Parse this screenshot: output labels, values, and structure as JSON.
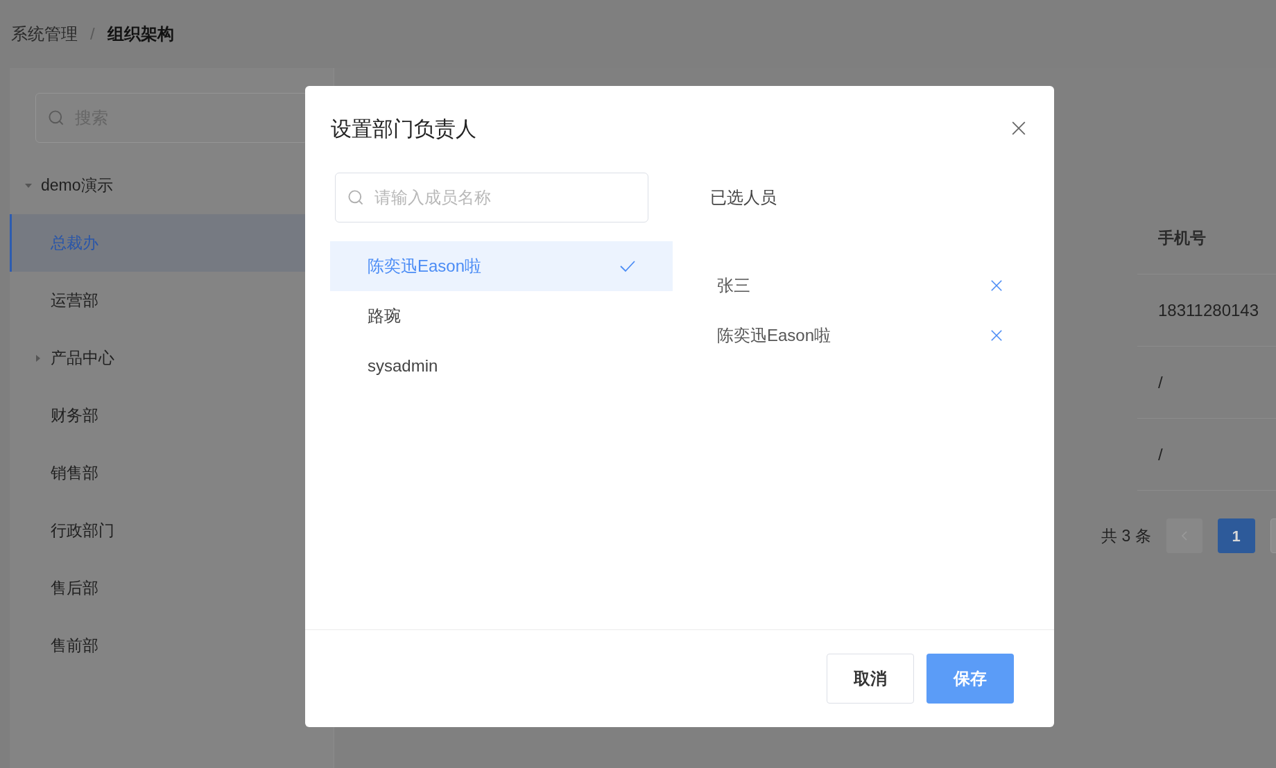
{
  "breadcrumb": {
    "items": [
      "系统管理",
      "组织架构"
    ],
    "separator": "/"
  },
  "sidebar": {
    "search": {
      "placeholder": "搜索"
    },
    "tree": [
      {
        "label": "demo演示",
        "kind": "group",
        "expanded": true,
        "selected": false,
        "children": [
          {
            "label": "总裁办",
            "kind": "leaf",
            "selected": true
          },
          {
            "label": "运营部",
            "kind": "leaf",
            "selected": false
          },
          {
            "label": "产品中心",
            "kind": "group",
            "expanded": false,
            "selected": false
          },
          {
            "label": "财务部",
            "kind": "leaf",
            "selected": false
          },
          {
            "label": "销售部",
            "kind": "leaf",
            "selected": false
          },
          {
            "label": "行政部门",
            "kind": "leaf",
            "selected": false
          },
          {
            "label": "售后部",
            "kind": "leaf",
            "selected": false
          },
          {
            "label": "售前部",
            "kind": "leaf",
            "selected": false
          }
        ]
      }
    ]
  },
  "table": {
    "columns": [
      "手机号"
    ],
    "rows": [
      [
        "18311280143"
      ],
      [
        "/"
      ],
      [
        "/"
      ]
    ]
  },
  "pagination": {
    "total": "共 3 条",
    "prev_disabled": true,
    "pages": [
      {
        "label": "1",
        "selected": true
      }
    ]
  },
  "modal": {
    "title": "设置部门负责人",
    "search": {
      "placeholder": "请输入成员名称"
    },
    "members": [
      {
        "name": "陈奕迅Eason啦",
        "selected": true
      },
      {
        "name": "路琬",
        "selected": false
      },
      {
        "name": "sysadmin",
        "selected": false
      }
    ],
    "chosen_title": "已选人员",
    "chosen": [
      {
        "name": "张三"
      },
      {
        "name": "陈奕迅Eason啦"
      }
    ],
    "buttons": [
      {
        "label": "取消",
        "kind": "default"
      },
      {
        "label": "保存",
        "kind": "primary"
      }
    ]
  }
}
